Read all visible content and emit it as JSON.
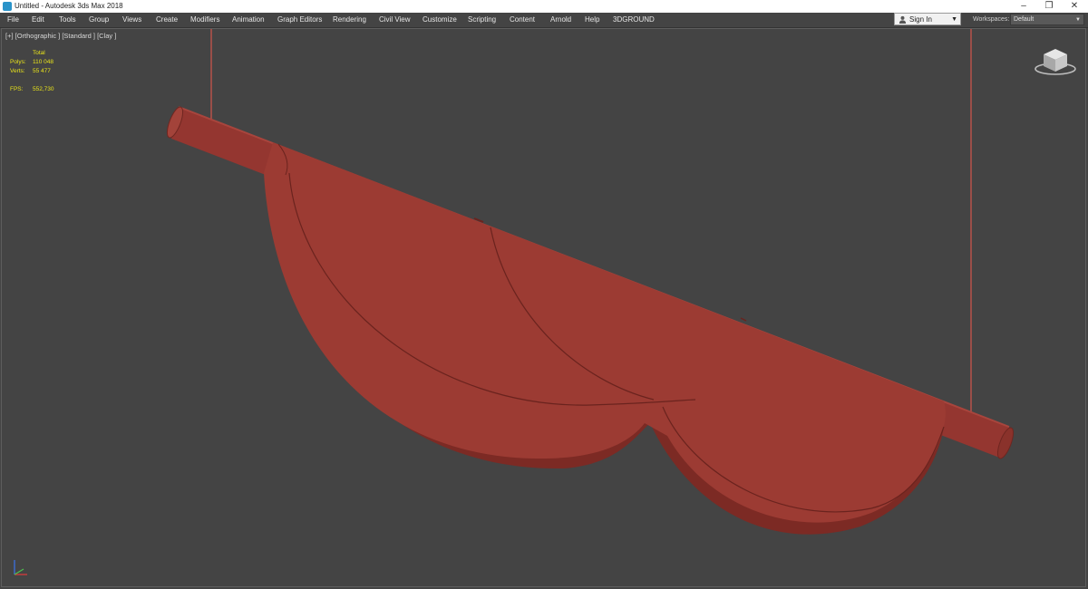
{
  "window": {
    "title": "Untitled - Autodesk 3ds Max 2018",
    "minimize": "–",
    "restore": "❐",
    "close": "✕"
  },
  "menu": [
    "File",
    "Edit",
    "Tools",
    "Group",
    "Views",
    "Create",
    "Modifiers",
    "Animation",
    "Graph Editors",
    "Rendering",
    "Civil View",
    "Customize",
    "Scripting",
    "Content",
    "Arnold",
    "Help",
    "3DGROUND"
  ],
  "signin": {
    "label": "Sign In",
    "arrow": "▼"
  },
  "workspaces": {
    "label": "Workspaces:",
    "value": "Default",
    "arrow": "▼"
  },
  "viewport": {
    "label": "[+] [Orthographic ] [Standard ] [Clay ]",
    "stats": {
      "header": "Total",
      "polys_label": "Polys:",
      "polys_value": "110 048",
      "verts_label": "Verts:",
      "verts_value": "55 477",
      "fps_label": "FPS:",
      "fps_value": "552,730"
    }
  },
  "icons": {
    "app": "3ds-max-app-icon",
    "user": "user-icon",
    "viewcube": "viewcube-icon",
    "axis": "axis-tripod-icon"
  },
  "colors": {
    "viewport_bg": "#444444",
    "clay": "#9c3b33",
    "clay_dark": "#7c2a24",
    "wire": "#c0534a",
    "stats": "#e8e31a"
  }
}
